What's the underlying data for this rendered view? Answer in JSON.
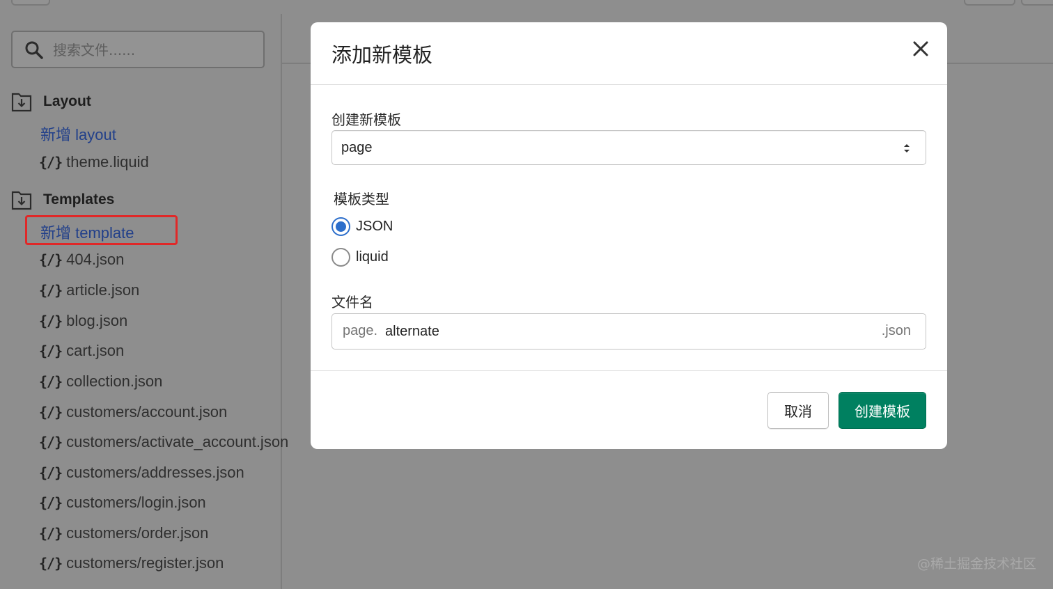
{
  "sidebar": {
    "search_placeholder": "搜索文件......",
    "sections": [
      {
        "title": "Layout",
        "add_link": "新增 layout",
        "files": [
          "theme.liquid"
        ]
      },
      {
        "title": "Templates",
        "add_link": "新增 template",
        "files": [
          "404.json",
          "article.json",
          "blog.json",
          "cart.json",
          "collection.json",
          "customers/account.json",
          "customers/activate_account.json",
          "customers/addresses.json",
          "customers/login.json",
          "customers/order.json",
          "customers/register.json"
        ]
      }
    ],
    "code_icon_glyph": "{/}"
  },
  "modal": {
    "title": "添加新模板",
    "create_label": "创建新模板",
    "template_select_value": "page",
    "type_label": "模板类型",
    "type_options": [
      {
        "label": "JSON",
        "checked": true
      },
      {
        "label": "liquid",
        "checked": false
      }
    ],
    "filename_label": "文件名",
    "filename_prefix": "page.",
    "filename_value": "alternate",
    "filename_suffix": ".json",
    "cancel_label": "取消",
    "submit_label": "创建模板"
  },
  "watermark": "@稀土掘金技术社区",
  "colors": {
    "primary_button": "#008060",
    "radio_accent": "#2c6ecb",
    "highlight_border": "#e02828",
    "link": "#22408a"
  }
}
